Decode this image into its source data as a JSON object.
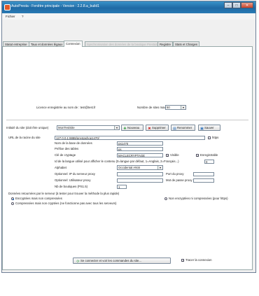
{
  "window": {
    "title": "AutoPresta - Fenêtre principale - Version : 2.2.8.a_build1"
  },
  "menu": {
    "items": [
      "Fichier",
      "?"
    ]
  },
  "tabs": [
    {
      "label": "Statut entreprise"
    },
    {
      "label": "Taux et données légaux"
    },
    {
      "label": "Connexion"
    },
    {
      "label": "Synchronisation des données de ta boutique PrestaShop"
    },
    {
      "label": "Registre"
    },
    {
      "label": "Stats et Charges"
    }
  ],
  "license": {
    "label": "Licence enregistrée au nom de : test@test.fr",
    "max_sites_label": "Nombre de sites max",
    "max_sites_value": "50"
  },
  "site_bar": {
    "label": "Intitulé du site (doit être unique)",
    "site_value": "MonTestSite",
    "btn_new": "Nouveau",
    "btn_delete": "Supprimer",
    "btn_rename": "Renommer",
    "btn_save": "Sauver"
  },
  "form": {
    "url_label": "URL de la racine du site",
    "url_value": "127.0.0.1:8888/prestashop1470/",
    "https_label": "https",
    "db_name_label": "Nom de la base de données",
    "db_name_value": "ps1470",
    "prefix_label": "Préfixe des tables",
    "prefix_value": "ps_",
    "key_label": "Clé de cryptage",
    "key_value": "MACLECRYPTAGE",
    "visible_label": "Visible",
    "saveable_label": "Enregistrable",
    "lang_label": "Id de la langue utilisé pour afficher le contenu (0=langue par défaut, 1=Anglais, 2=Français...)",
    "lang_value": "0",
    "alphabet_label": "Alphabet",
    "alphabet_value": "Occidental ANSI",
    "proxy_ip_label": "Optionnel: IP du serveur proxy",
    "proxy_port_label": "Port du proxy",
    "proxy_user_label": "Optionnel: Utilisateur proxy",
    "proxy_pass_label": "Mot de passe proxy",
    "loops_label": "Nb de boutiques (PS1.5)",
    "loops_value": "1"
  },
  "transfer": {
    "title": "Données retournées par le serveur (à tester pour trouver la méthode la plus rapide)",
    "opt1": "Encryptées mais non compressées",
    "opt2": "Non encryptées ni compressées (pour https)",
    "opt3": "Compressées mais non cryptées (ne fonctionne pas avec tous les serveurs)"
  },
  "footer": {
    "connect_label": "Se connecter et voir les commandes du site...",
    "trace_label": "Tracer la connexion"
  },
  "colors": {
    "titlebar": "#1f6aa5",
    "accent": "#2a6fb8"
  }
}
